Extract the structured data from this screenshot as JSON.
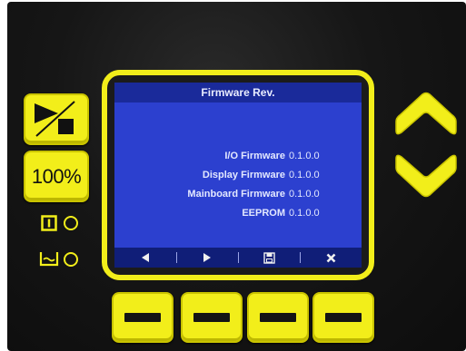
{
  "screen": {
    "title": "Firmware Rev.",
    "rows": [
      {
        "label": "I/O Firmware",
        "value": "0.1.0.0"
      },
      {
        "label": "Display Firmware",
        "value": "0.1.0.0"
      },
      {
        "label": "Mainboard Firmware",
        "value": "0.1.0.0"
      },
      {
        "label": "EEPROM",
        "value": "0.1.0.0"
      }
    ],
    "softkeys": [
      {
        "icon": "triangle-left-icon"
      },
      {
        "icon": "triangle-right-icon"
      },
      {
        "icon": "save-icon"
      },
      {
        "icon": "close-icon"
      }
    ]
  },
  "left_keys": {
    "start_stop_icon": "play-stop-icon",
    "speed_label": "100%",
    "indicators": [
      {
        "icon": "external-contact-icon",
        "led": "off"
      },
      {
        "icon": "container-level-icon",
        "led": "off"
      }
    ]
  },
  "right_keys": [
    {
      "icon": "chevron-up-icon"
    },
    {
      "icon": "chevron-down-icon"
    }
  ],
  "colors": {
    "key_yellow": "#f2ee1a",
    "screen_blue": "#2c40cf",
    "bar_blue": "#1a2a9a",
    "panel_black": "#111111"
  }
}
